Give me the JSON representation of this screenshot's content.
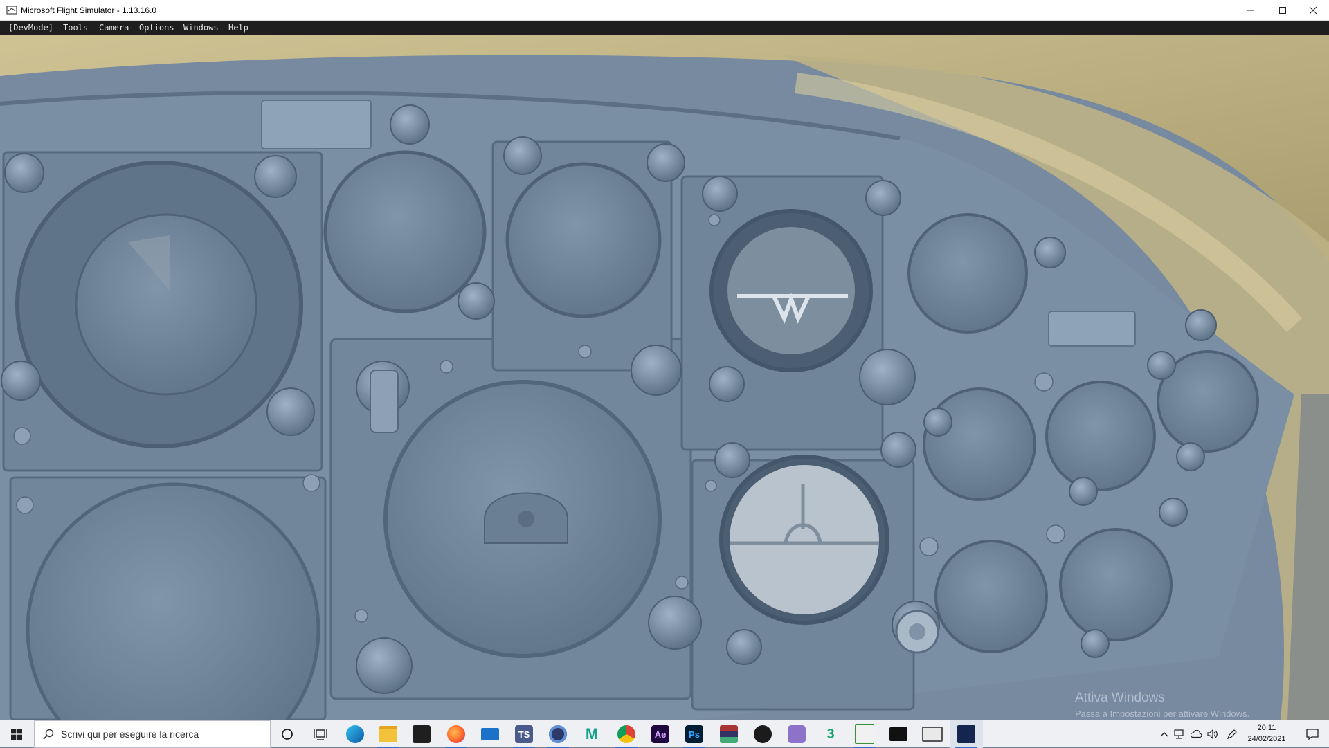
{
  "window": {
    "title": "Microsoft Flight Simulator - 1.13.16.0",
    "app_icon": "flight-sim-app-icon",
    "controls": [
      "minimize-icon",
      "maximize-icon",
      "close-icon"
    ]
  },
  "menubar": {
    "items": [
      {
        "label": "[DevMode]"
      },
      {
        "label": "Tools"
      },
      {
        "label": "Camera"
      },
      {
        "label": "Options"
      },
      {
        "label": "Windows"
      },
      {
        "label": "Help"
      }
    ]
  },
  "scene": {
    "description_icon": "cockpit-instrument-panel",
    "colors": {
      "panel": "#7a8ea3",
      "canopy": "#b9ac7e",
      "shadow": "#4f6378"
    }
  },
  "watermark": {
    "title": "Attiva Windows",
    "subtitle": "Passa a Impostazioni per attivare Windows."
  },
  "taskbar": {
    "search_placeholder": "Scrivi qui per eseguire la ricerca",
    "pinned": [
      {
        "name": "cortana-icon"
      },
      {
        "name": "task-view-icon"
      },
      {
        "name": "edge-icon"
      },
      {
        "name": "file-explorer-icon"
      },
      {
        "name": "store-icon"
      },
      {
        "name": "firefox-icon"
      },
      {
        "name": "mail-icon"
      },
      {
        "name": "teamspeak-icon"
      },
      {
        "name": "app-circle-icon"
      },
      {
        "name": "msfs-m-icon"
      },
      {
        "name": "chrome-icon"
      },
      {
        "name": "after-effects-icon"
      },
      {
        "name": "photoshop-icon"
      },
      {
        "name": "winrar-icon"
      },
      {
        "name": "xbox-icon"
      },
      {
        "name": "snip-tool-icon"
      },
      {
        "name": "app-3-icon"
      },
      {
        "name": "task-manager-icon"
      },
      {
        "name": "terminal-icon"
      },
      {
        "name": "window-app-icon"
      },
      {
        "name": "flight-sim-taskbar-icon"
      }
    ],
    "glyph_labels": {
      "ts": "TS",
      "m": "M",
      "ae": "Ae",
      "ps": "Ps",
      "three": "3"
    },
    "tray": [
      "chevron-up-icon",
      "network-icon",
      "onedrive-icon",
      "volume-icon",
      "pen-icon"
    ],
    "clock": {
      "time": "20:11",
      "date": "24/02/2021"
    },
    "notification_icon": "notification-icon"
  }
}
